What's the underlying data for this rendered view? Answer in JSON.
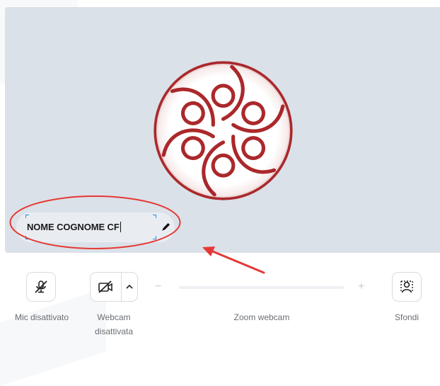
{
  "preview": {
    "participant_name": "NOME COGNOME CF"
  },
  "controls": {
    "mic_label": "Mic disattivato",
    "webcam_label_line1": "Webcam",
    "webcam_label_line2": "disattivata",
    "zoom_label": "Zoom webcam",
    "zoom_minus": "−",
    "zoom_plus": "+",
    "backgrounds_label": "Sfondi"
  },
  "icons": {
    "logo": "rosette-logo-icon",
    "edit": "pencil-icon",
    "mic": "mic-off-icon",
    "webcam": "camera-off-icon",
    "webcam_options": "chevron-up-icon",
    "backgrounds": "person-background-icon"
  },
  "colors": {
    "preview_bg": "#dbe1e8",
    "logo_red": "#a4161a",
    "annotation_red": "#e53935",
    "focus_blue": "#1e8fe0"
  }
}
